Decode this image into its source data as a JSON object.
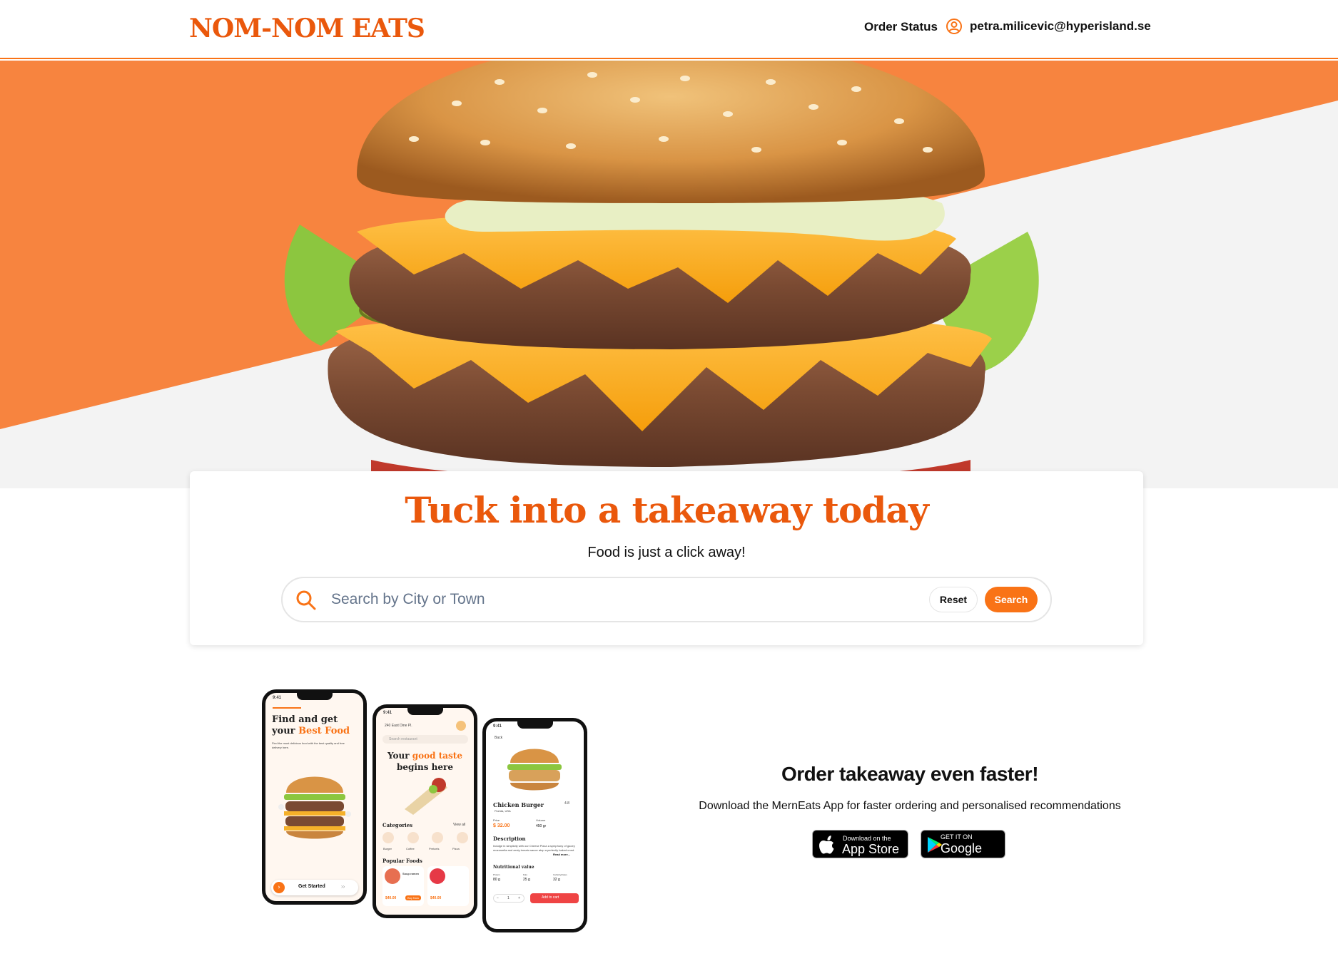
{
  "header": {
    "logo": "NOM-NOM EATS",
    "order_status": "Order Status",
    "user_email": "petra.milicevic@hyperisland.se"
  },
  "hero": {
    "title": "Tuck into a takeaway today",
    "subtitle": "Food is just a click away!"
  },
  "search": {
    "placeholder": "Search by City or Town",
    "reset_label": "Reset",
    "search_label": "Search"
  },
  "phones": {
    "phone1": {
      "title_line1": "Find and get",
      "title_line2_prefix": "your",
      "title_line2_accent": "Best Food",
      "blurb": "Find the most delicious food with the best quality and free delivery here.",
      "cta": "Get Started",
      "time": "9:41"
    },
    "phone2": {
      "location": "240 East Dine Pl.",
      "search_placeholder": "Search restaurant",
      "headline_prefix": "Your",
      "headline_accent": "good taste",
      "headline_line2": "begins here",
      "categories_label": "Categories",
      "view_all": "View all",
      "categories": [
        "Burger",
        "Coffee",
        "Pretzels",
        "Pizza"
      ],
      "popular_label": "Popular Foods",
      "item1_name": "Soup ramen",
      "item1_price": "$40.00",
      "item2_price": "$40.00",
      "buy_now": "Buy Now",
      "time": "9:41"
    },
    "phone3": {
      "back": "Back",
      "item_name": "Chicken Burger",
      "rating": "4.8",
      "location": "Florida, USA",
      "price_label": "Price",
      "price": "$ 32.00",
      "volume_label": "Volume",
      "volume": "450 gr",
      "description_label": "Description",
      "description": "Indulge in simplicity with our Cheese Pizza a symphony of gooey mozzarella and zesty tomato sauce atop a perfectly baked crust.",
      "read_more": "Read more...",
      "nutrition_label": "Nutritional value",
      "nutrition": [
        {
          "label": "Protein",
          "value": "80 g"
        },
        {
          "label": "Fats",
          "value": "25 g"
        },
        {
          "label": "Carbohydrates",
          "value": "32 g"
        }
      ],
      "quantity": "1",
      "add_to_cart": "Add to cart",
      "time": "9:41"
    }
  },
  "promo": {
    "title": "Order takeaway even faster!",
    "subtitle": "Download the MernEats App for faster ordering and personalised recommendations",
    "app_store_small": "Download on the",
    "app_store_big": "App Store",
    "google_small": "GET IT ON",
    "google_big": "Google play"
  },
  "colors": {
    "brand_orange": "#f97316",
    "logo_orange": "#ea580c",
    "hero_orange": "#f7843f",
    "hero_gray": "#f3f3f3"
  }
}
